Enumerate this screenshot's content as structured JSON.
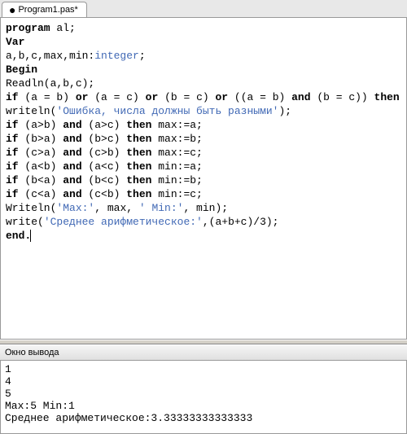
{
  "tab": {
    "title": "Program1.pas*",
    "dirty_marker": "●"
  },
  "code": {
    "l1a": "program",
    "l1b": " al;",
    "l2": "Var",
    "l3a": "a,b,c,max,min:",
    "l3b": "integer",
    "l3c": ";",
    "l4": "Begin",
    "l5": "Readln(a,b,c);",
    "l6a": "if",
    "l6b": " (a = b) ",
    "l6c": "or",
    "l6d": " (a = c) ",
    "l6e": "or",
    "l6f": " (b = c) ",
    "l6g": "or",
    "l6h": " ((a = b) ",
    "l6i": "and",
    "l6j": " (b = c)) ",
    "l6k": "then",
    "l7a": "writeln(",
    "l7b": "'Ошибка, числа должны быть разными'",
    "l7c": ");",
    "l8a": "if",
    "l8b": " (a>b) ",
    "l8c": "and",
    "l8d": " (a>c) ",
    "l8e": "then",
    "l8f": " max:=a;",
    "l9a": "if",
    "l9b": " (b>a) ",
    "l9c": "and",
    "l9d": " (b>c) ",
    "l9e": "then",
    "l9f": " max:=b;",
    "l10a": "if",
    "l10b": " (c>a) ",
    "l10c": "and",
    "l10d": " (c>b) ",
    "l10e": "then",
    "l10f": " max:=c;",
    "l11a": "if",
    "l11b": " (a<b) ",
    "l11c": "and",
    "l11d": " (a<c) ",
    "l11e": "then",
    "l11f": " min:=a;",
    "l12a": "if",
    "l12b": " (b<a) ",
    "l12c": "and",
    "l12d": " (b<c) ",
    "l12e": "then",
    "l12f": " min:=b;",
    "l13a": "if",
    "l13b": " (c<a) ",
    "l13c": "and",
    "l13d": " (c<b) ",
    "l13e": "then",
    "l13f": " min:=c;",
    "l14a": "Writeln(",
    "l14b": "'Max:'",
    "l14c": ", max, ",
    "l14d": "' Min:'",
    "l14e": ", min);",
    "l15a": "write(",
    "l15b": "'Среднее арифметическое:'",
    "l15c": ",(a+b+c)/3);",
    "l16": "end."
  },
  "output": {
    "title": "Окно вывода",
    "lines": "1\n4\n5\nMax:5 Min:1\nСреднее арифметическое:3.33333333333333"
  }
}
